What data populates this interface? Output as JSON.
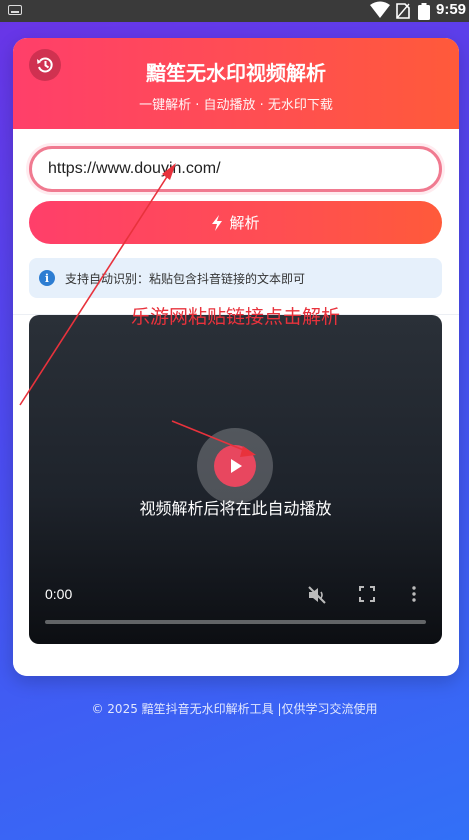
{
  "status_bar": {
    "time": "9:59",
    "icons": [
      "keyboard-icon",
      "wifi-icon",
      "sim-icon",
      "battery-icon"
    ]
  },
  "header": {
    "title": "黯笙无水印视频解析",
    "subtitle": "一键解析 · 自动播放 · 无水印下载",
    "history_icon": "history-icon"
  },
  "form": {
    "url_value": "https://www.douyin.com/",
    "parse_label": "解析",
    "parse_icon": "lightning-icon"
  },
  "tip": {
    "text": "支持自动识别：粘贴包含抖音链接的文本即可",
    "icon": "info-icon"
  },
  "video": {
    "message": "视频解析后将在此自动播放",
    "time": "0:00",
    "progress": 0,
    "controls": [
      "mute-icon",
      "fullscreen-icon",
      "more-icon"
    ]
  },
  "annotation": {
    "text": "乐游网粘贴链接点击解析",
    "color": "#e8323c"
  },
  "footer": {
    "text": "© 2025 黯笙抖音无水印解析工具 |仅供学习交流使用"
  },
  "colors": {
    "accent_start": "#ff3f6a",
    "accent_end": "#ff5a3a",
    "background_start": "#6a34e6",
    "background_end": "#3270f7"
  }
}
